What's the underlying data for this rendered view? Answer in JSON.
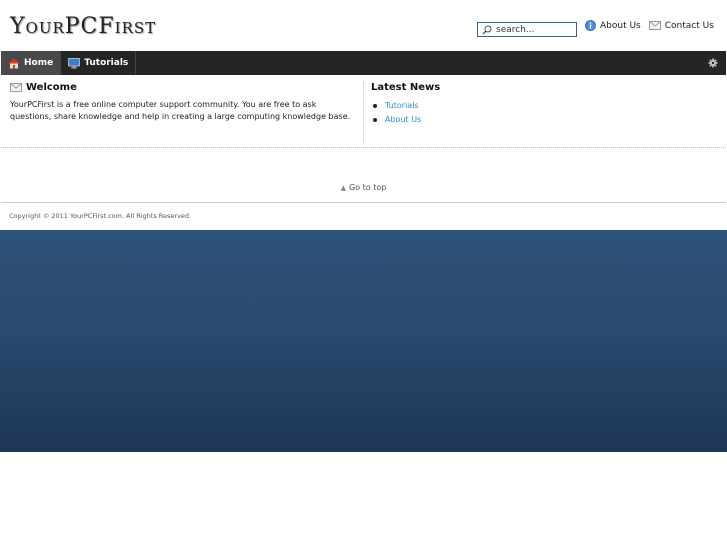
{
  "header": {
    "logo": "YourPCFirst",
    "search_placeholder": "search...",
    "links": [
      {
        "label": "About Us",
        "icon": "info-icon"
      },
      {
        "label": "Contact Us",
        "icon": "envelope-icon"
      }
    ]
  },
  "nav": {
    "items": [
      {
        "label": "Home",
        "icon": "house-icon",
        "active": true
      },
      {
        "label": "Tutorials",
        "icon": "monitor-icon",
        "active": false
      }
    ],
    "settings_icon": "gear-icon"
  },
  "welcome": {
    "title": "Welcome",
    "text": "YourPCFirst is a free online computer support community. You are free to ask questions, share knowledge and help in creating a large computing knowledge base."
  },
  "news": {
    "title": "Latest News",
    "items": [
      "Tutorials",
      "About Us"
    ]
  },
  "footer": {
    "go_to_top": "Go to top",
    "copyright": "Copyright © 2011 YourPCFirst.com. All Rights Reserved."
  },
  "colors": {
    "nav_bg": "#252525",
    "link": "#2a8fc0",
    "background_top": "#2f5279",
    "background_bottom": "#1d3556"
  }
}
